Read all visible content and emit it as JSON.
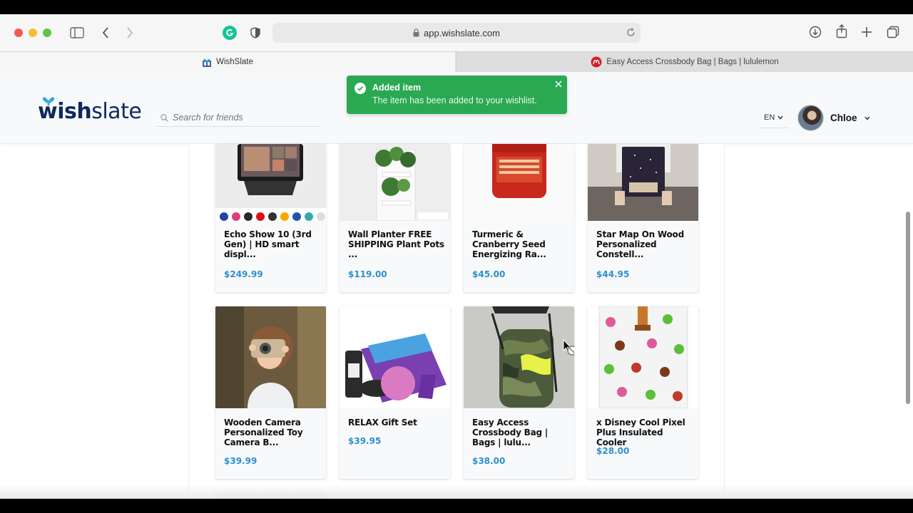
{
  "browser": {
    "url": "app.wishslate.com",
    "tabs": [
      {
        "label": "WishSlate",
        "active": true
      },
      {
        "label": "Easy Access Crossbody Bag | Bags | lululemon",
        "active": false
      }
    ]
  },
  "header": {
    "logo_text_bold": "wish",
    "logo_text_light": "slate",
    "search_placeholder": "Search for friends",
    "language": "EN",
    "user_name": "Chloe"
  },
  "toast": {
    "title": "Added item",
    "message": "The item has been added to your wishlist."
  },
  "items": [
    {
      "title": "Echo Show 10 (3rd Gen) | HD smart displ...",
      "price": "$249.99"
    },
    {
      "title": "Wall Planter FREE SHIPPING Plant Pots ...",
      "price": "$119.00"
    },
    {
      "title": "Turmeric & Cranberry Seed Energizing Ra...",
      "price": "$45.00"
    },
    {
      "title": "Star Map On Wood Personalized Constell...",
      "price": "$44.95"
    },
    {
      "title": "Wooden Camera Personalized Toy Camera B...",
      "price": "$39.99"
    },
    {
      "title": "RELAX Gift Set",
      "price": "$39.95"
    },
    {
      "title": "Easy Access Crossbody Bag | Bags | lulu...",
      "price": "$38.00"
    },
    {
      "title": "x Disney Cool Pixel Plus Insulated Cooler",
      "price": "$28.00"
    }
  ],
  "colors": {
    "toast_green": "#2aa952",
    "price_blue": "#2c8fcf",
    "logo_navy": "#0e2a5c",
    "logo_bow": "#2fa8e0"
  }
}
